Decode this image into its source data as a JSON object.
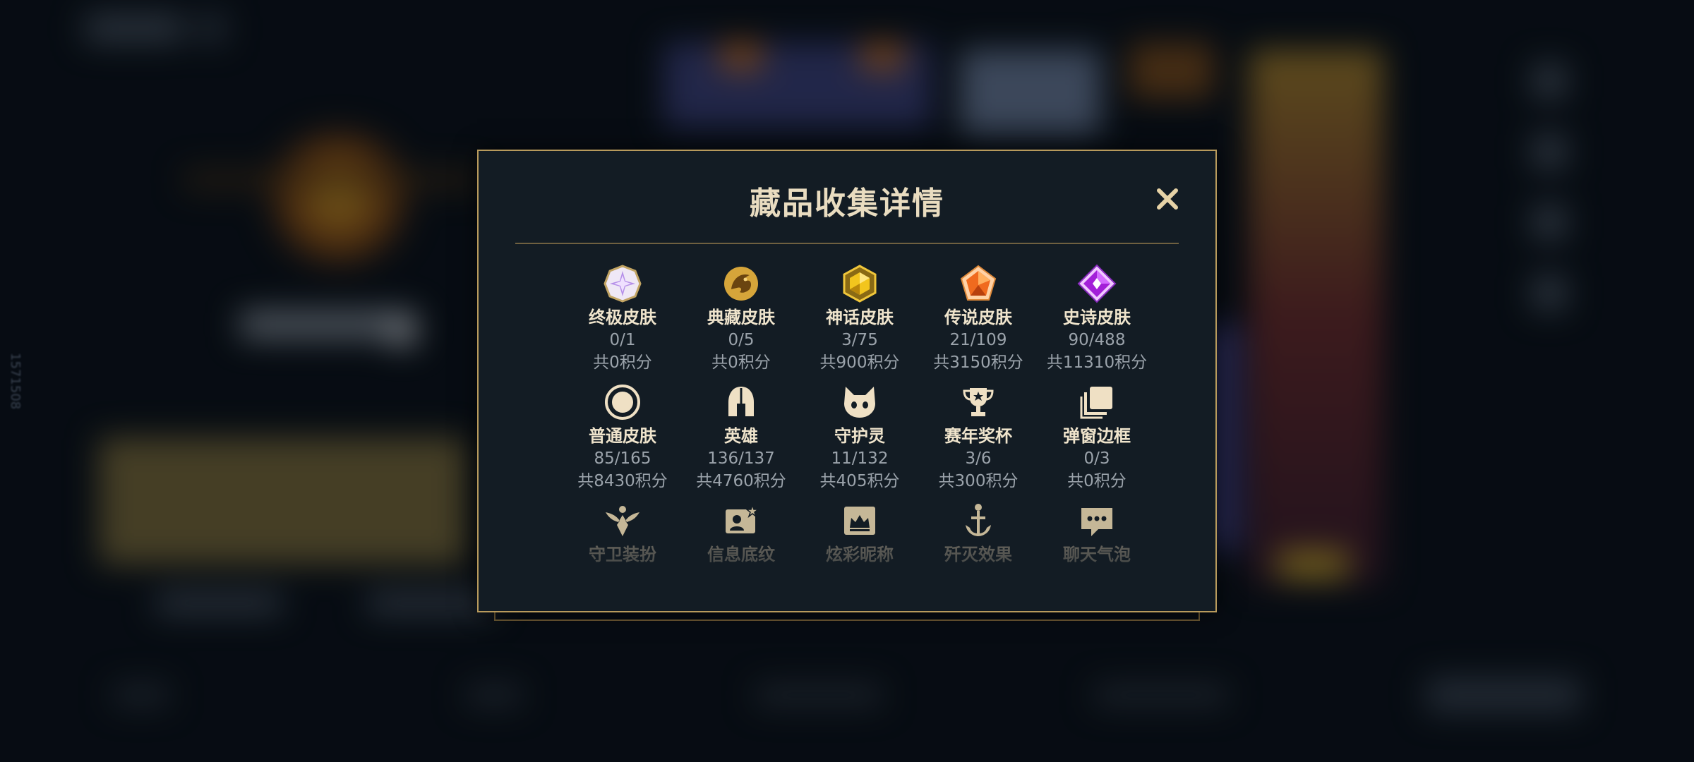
{
  "modal": {
    "title": "藏品收集详情",
    "items": [
      {
        "name": "终极皮肤",
        "count": "0/1",
        "points": "共0积分",
        "icon": "ultimate-skin-icon"
      },
      {
        "name": "典藏皮肤",
        "count": "0/5",
        "points": "共0积分",
        "icon": "collector-skin-icon"
      },
      {
        "name": "神话皮肤",
        "count": "3/75",
        "points": "共900积分",
        "icon": "mythic-skin-icon"
      },
      {
        "name": "传说皮肤",
        "count": "21/109",
        "points": "共3150积分",
        "icon": "legendary-skin-icon"
      },
      {
        "name": "史诗皮肤",
        "count": "90/488",
        "points": "共11310积分",
        "icon": "epic-skin-icon"
      },
      {
        "name": "普通皮肤",
        "count": "85/165",
        "points": "共8430积分",
        "icon": "normal-skin-icon"
      },
      {
        "name": "英雄",
        "count": "136/137",
        "points": "共4760积分",
        "icon": "helmet-icon"
      },
      {
        "name": "守护灵",
        "count": "11/132",
        "points": "共405积分",
        "icon": "pet-icon"
      },
      {
        "name": "赛年奖杯",
        "count": "3/6",
        "points": "共300积分",
        "icon": "trophy-icon"
      },
      {
        "name": "弹窗边框",
        "count": "0/3",
        "points": "共0积分",
        "icon": "frame-icon"
      },
      {
        "name": "守卫装扮",
        "icon": "ward-skin-icon"
      },
      {
        "name": "信息底纹",
        "icon": "profile-card-icon"
      },
      {
        "name": "炫彩昵称",
        "icon": "nickname-icon"
      },
      {
        "name": "歼灭效果",
        "icon": "elimination-effect-icon"
      },
      {
        "name": "聊天气泡",
        "icon": "chat-bubble-icon"
      }
    ]
  },
  "background": {
    "side_id": "1571508"
  },
  "colors": {
    "accent_gold": "#b89a5c",
    "title_text": "#e9dcc0",
    "panel_bg": "#131c24"
  }
}
